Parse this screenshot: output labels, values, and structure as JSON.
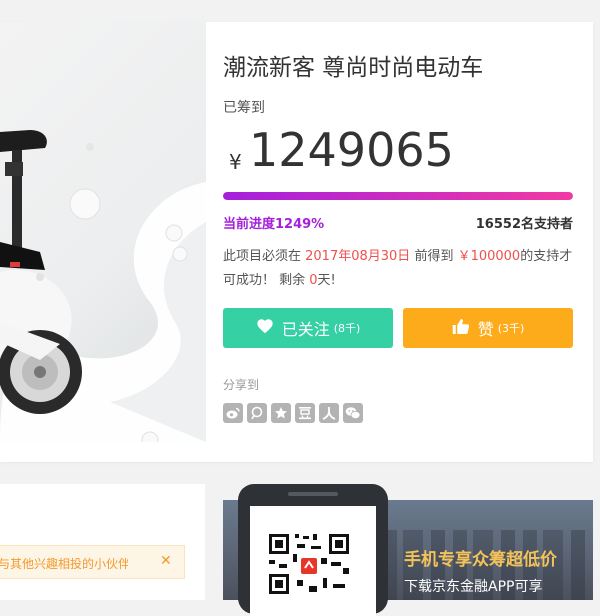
{
  "project": {
    "title": "潮流新客 尊尚时尚电动车",
    "raised_label": "已筹到",
    "currency": "¥",
    "amount": "1249065",
    "progress_percent": 1249,
    "progress_text": "当前进度1249%",
    "supporters_text": "16552名支持者",
    "note": {
      "p1": "此项目必须在 ",
      "date": "2017年08月30日",
      "p2": " 前得到 ",
      "target": "￥100000",
      "p3": "的支持才可成功！ 剩余 ",
      "days": "0",
      "p4": "天!"
    }
  },
  "actions": {
    "follow": {
      "label": "已关注",
      "count": "(8千)",
      "color": "#35d0a4",
      "icon": "heart-icon"
    },
    "like": {
      "label": "赞",
      "count": "(3千)",
      "color": "#fdab1a",
      "icon": "thumbs-up-icon"
    }
  },
  "share": {
    "label": "分享到",
    "icons": [
      {
        "name": "weibo-icon",
        "glyph": "微"
      },
      {
        "name": "qzone-icon",
        "glyph": "Q"
      },
      {
        "name": "favorite-star-icon",
        "glyph": "★"
      },
      {
        "name": "douban-icon",
        "glyph": "豆"
      },
      {
        "name": "renren-icon",
        "glyph": "人"
      },
      {
        "name": "wechat-icon",
        "glyph": "微"
      }
    ]
  },
  "notice": {
    "text": "与其他兴趣相投的小伙伴",
    "close": "✕"
  },
  "app_banner": {
    "title": "手机专享众筹超低价",
    "subtitle": "下载京东金融APP可享"
  },
  "colors": {
    "progress_start": "#a51fdc",
    "progress_end": "#f23aa4",
    "highlight": "#f0504c"
  }
}
